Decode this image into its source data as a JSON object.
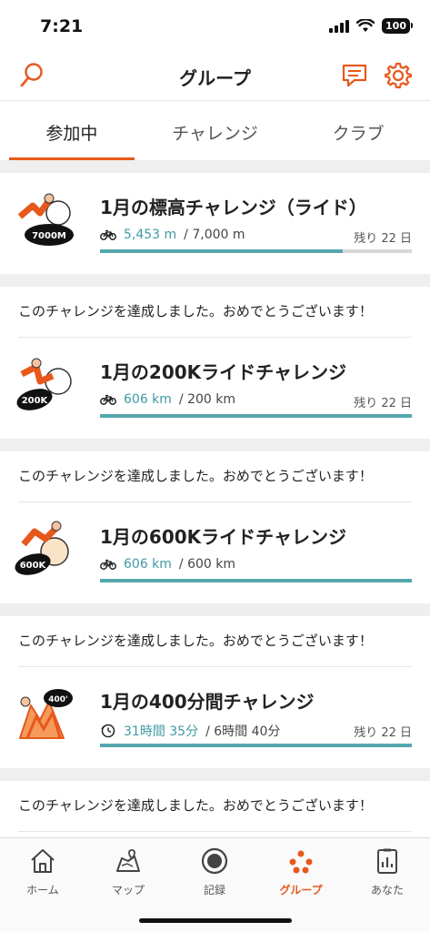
{
  "status": {
    "time": "7:21",
    "battery": "100"
  },
  "header": {
    "title": "グループ",
    "left_icon": "search-icon",
    "right_icons": [
      "chat-icon",
      "gear-icon"
    ]
  },
  "tabs": [
    {
      "label": "参加中",
      "active": true
    },
    {
      "label": "チャレンジ",
      "active": false
    },
    {
      "label": "クラブ",
      "active": false
    }
  ],
  "challenges": [
    {
      "name": "1月の標高チャレンジ（ライド）",
      "icon": "bike-icon",
      "current": "5,453 m",
      "total": "/ 7,000 m",
      "remaining": "残り 22 日",
      "progress": 0.779,
      "badge": "7000M"
    },
    {
      "name": "1月の200Kライドチャレンジ",
      "icon": "bike-icon",
      "current": "606 km",
      "total": "/ 200 km",
      "remaining": "残り 22 日",
      "progress": 1.0,
      "badge": "200K"
    },
    {
      "name": "1月の600Kライドチャレンジ",
      "icon": "bike-icon",
      "current": "606 km",
      "total": "/ 600 km",
      "remaining": "",
      "progress": 1.0,
      "badge": "600K"
    },
    {
      "name": "1月の400分間チャレンジ",
      "icon": "timer-icon",
      "current": "31時間 35分",
      "total": "/ 6時間 40分",
      "remaining": "残り 22 日",
      "progress": 1.0,
      "badge": "400'"
    }
  ],
  "congrats_message": "このチャレンジを達成しました。おめでとうございます！",
  "tabbar": [
    {
      "label": "ホーム",
      "icon": "home-icon",
      "active": false
    },
    {
      "label": "マップ",
      "icon": "map-icon",
      "active": false
    },
    {
      "label": "記録",
      "icon": "record-icon",
      "active": false
    },
    {
      "label": "グループ",
      "icon": "group-icon",
      "active": true
    },
    {
      "label": "あなた",
      "icon": "profile-icon",
      "active": false
    }
  ],
  "colors": {
    "accent": "#e7581c",
    "progress": "#55a7ae",
    "progress_text": "#3f9aa5"
  }
}
